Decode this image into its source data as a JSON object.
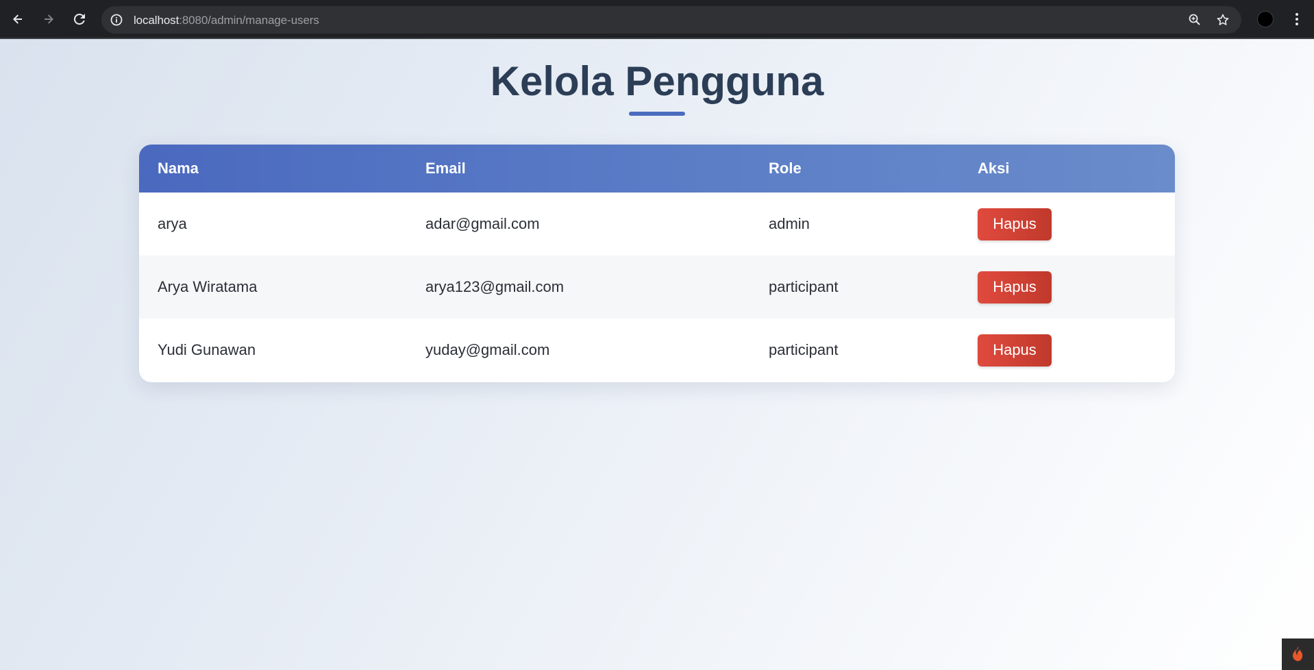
{
  "browser": {
    "url_host": "localhost",
    "url_path": ":8080/admin/manage-users"
  },
  "page": {
    "title": "Kelola Pengguna"
  },
  "table": {
    "headers": [
      "Nama",
      "Email",
      "Role",
      "Aksi"
    ],
    "rows": [
      {
        "nama": "arya",
        "email": "adar@gmail.com",
        "role": "admin",
        "action": "Hapus"
      },
      {
        "nama": "Arya Wiratama",
        "email": "arya123@gmail.com",
        "role": "participant",
        "action": "Hapus"
      },
      {
        "nama": "Yudi Gunawan",
        "email": "yuday@gmail.com",
        "role": "participant",
        "action": "Hapus"
      }
    ]
  },
  "colors": {
    "title": "#2c3e56",
    "header_start": "#4a69bf",
    "header_end": "#6a8ccb",
    "delete_button": "#d9463a"
  },
  "icons": {
    "back": "arrow-left-icon",
    "forward": "arrow-right-icon",
    "reload": "reload-icon",
    "site_info": "info-icon",
    "zoom": "zoom-icon",
    "bookmark": "star-icon",
    "menu": "kebab-menu-icon",
    "debug_toolbar": "flame-icon"
  }
}
